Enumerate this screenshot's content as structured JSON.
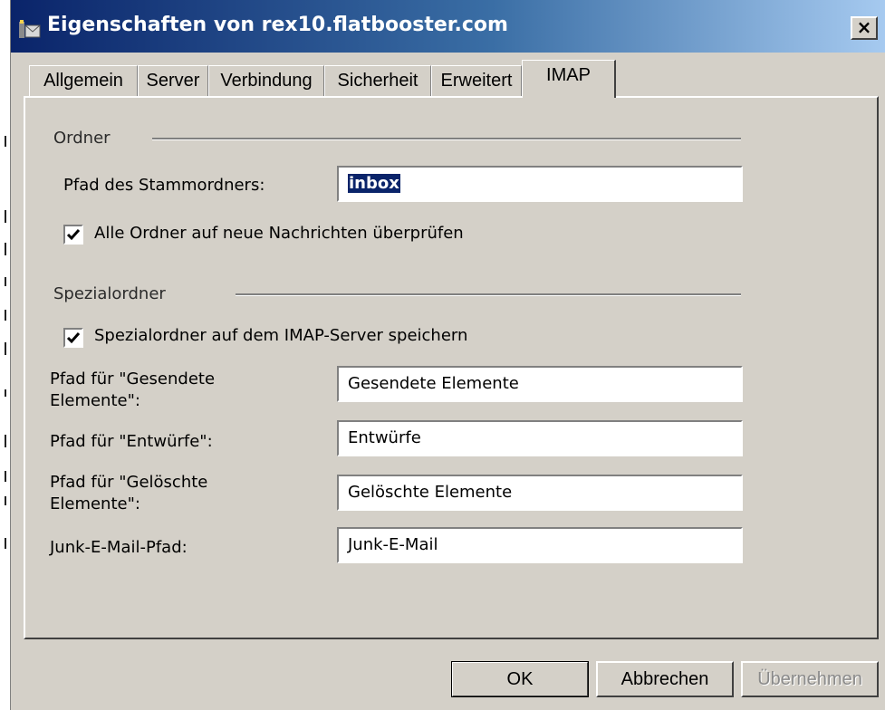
{
  "window": {
    "title": "Eigenschaften von rex10.flatbooster.com",
    "close_label": "×"
  },
  "tabs": [
    {
      "label": "Allgemein"
    },
    {
      "label": "Server"
    },
    {
      "label": "Verbindung"
    },
    {
      "label": "Sicherheit"
    },
    {
      "label": "Erweitert"
    },
    {
      "label": "IMAP"
    }
  ],
  "ordner": {
    "group_title": "Ordner",
    "root_path_label": "Pfad des Stammordners:",
    "root_path_value": "inbox",
    "check_all_label": "Alle Ordner auf neue Nachrichten überprüfen",
    "check_all_checked": true
  },
  "spezialordner": {
    "group_title": "Spezialordner",
    "store_label": "Spezialordner auf dem IMAP-Server speichern",
    "store_checked": true,
    "sent_label_line1": "Pfad für \"Gesendete",
    "sent_label_line2": "Elemente\":",
    "sent_value": "Gesendete Elemente",
    "drafts_label": "Pfad für \"Entwürfe\":",
    "drafts_value": "Entwürfe",
    "deleted_label_line1": "Pfad für \"Gelöschte",
    "deleted_label_line2": "Elemente\":",
    "deleted_value": "Gelöschte Elemente",
    "junk_label": "Junk-E-Mail-Pfad:",
    "junk_value": "Junk-E-Mail"
  },
  "buttons": {
    "ok": "OK",
    "cancel": "Abbrechen",
    "apply": "Übernehmen"
  }
}
